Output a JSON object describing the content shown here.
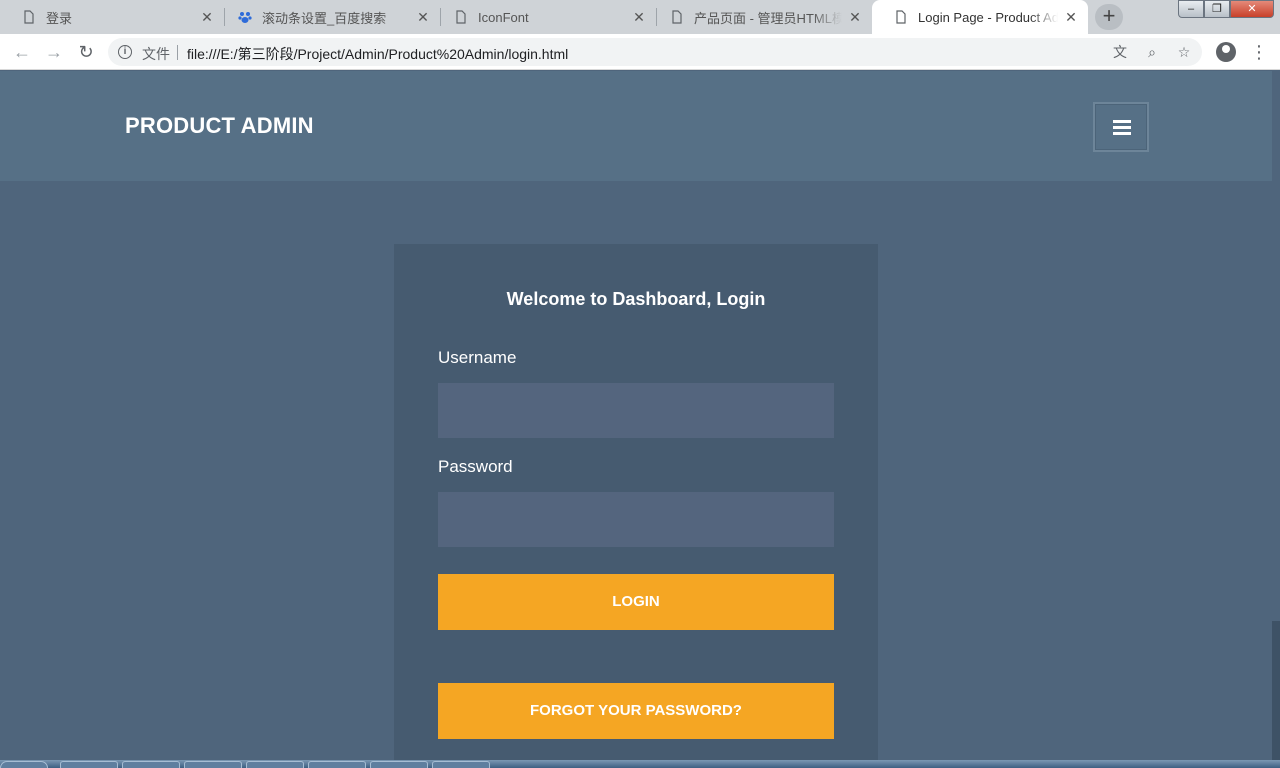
{
  "browser": {
    "tabs": [
      {
        "title": "登录",
        "active": false,
        "icon": "page-icon"
      },
      {
        "title": "滚动条设置_百度搜索",
        "active": false,
        "icon": "baidu-paw-icon"
      },
      {
        "title": "IconFont",
        "active": false,
        "icon": "page-icon"
      },
      {
        "title": "产品页面 - 管理员HTML模板",
        "active": false,
        "icon": "page-icon"
      },
      {
        "title": "Login Page - Product Admin",
        "active": true,
        "icon": "page-icon"
      }
    ],
    "scheme_label": "文件",
    "url": "file:///E:/第三阶段/Project/Admin/Product%20Admin/login.html"
  },
  "header": {
    "brand": "PRODUCT ADMIN"
  },
  "login": {
    "title": "Welcome to Dashboard, Login",
    "username_label": "Username",
    "username_value": "",
    "password_label": "Password",
    "password_value": "",
    "login_button": "LOGIN",
    "forgot_button": "FORGOT YOUR PASSWORD?"
  },
  "colors": {
    "header_bg": "#567086",
    "page_bg": "#4f657c",
    "card_bg": "#465b70",
    "input_bg": "#54657e",
    "accent": "#f5a623"
  }
}
